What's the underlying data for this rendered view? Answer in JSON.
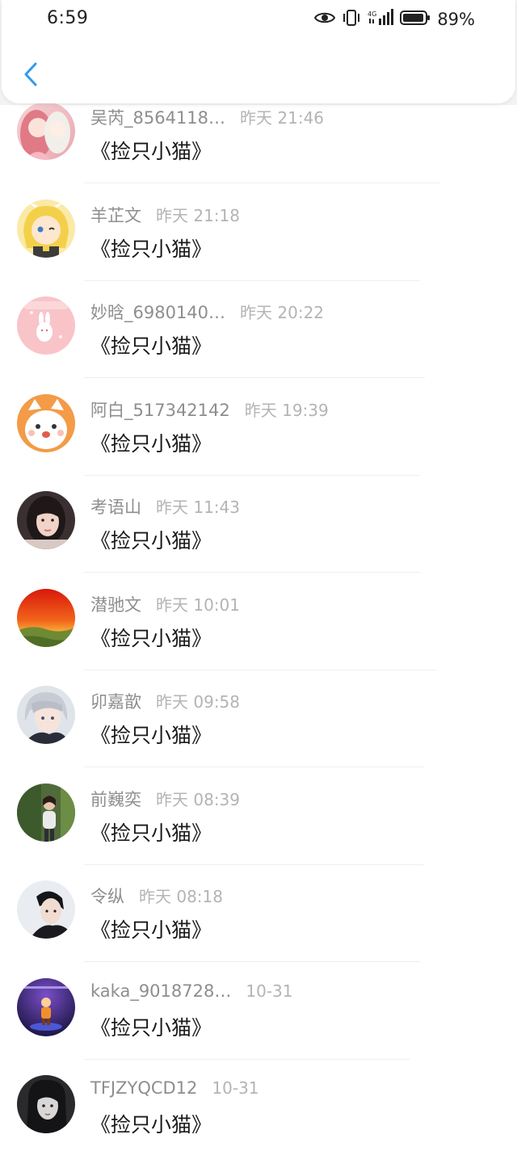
{
  "status_bar": {
    "time": "6:59",
    "network": "4G",
    "battery": "89%",
    "icons": [
      "eye-icon",
      "vibrate-icon",
      "signal-icon",
      "battery-icon"
    ]
  },
  "header": {
    "back_icon": "chevron-left-icon",
    "accent": "#2f9bf0"
  },
  "messages": [
    {
      "name": "吴芮_8564118…",
      "time": "昨天 21:46",
      "text": "《捡只小猫》",
      "avatar": "anime-girls"
    },
    {
      "name": "羊芷文",
      "time": "昨天 21:18",
      "text": "《捡只小猫》",
      "avatar": "anime-blonde"
    },
    {
      "name": "妙晗_6980140…",
      "time": "昨天 20:22",
      "text": "《捡只小猫》",
      "avatar": "pink-bunny"
    },
    {
      "name": "阿白_517342142",
      "time": "昨天 19:39",
      "text": "《捡只小猫》",
      "avatar": "orange-cartoon"
    },
    {
      "name": "考语山",
      "time": "昨天 11:43",
      "text": "《捡只小猫》",
      "avatar": "portrait-dark"
    },
    {
      "name": "潜驰文",
      "time": "昨天 10:01",
      "text": "《捡只小猫》",
      "avatar": "sunset"
    },
    {
      "name": "卯嘉歆",
      "time": "昨天 09:58",
      "text": "《捡只小猫》",
      "avatar": "anime-silver"
    },
    {
      "name": "前巍奕",
      "time": "昨天 08:39",
      "text": "《捡只小猫》",
      "avatar": "outdoor-girl"
    },
    {
      "name": "令纵",
      "time": "昨天 08:18",
      "text": "《捡只小猫》",
      "avatar": "portrait-boy"
    },
    {
      "name": "kaka_9018728…",
      "time": "10-31",
      "text": "《捡只小猫》",
      "avatar": "stage-purple"
    },
    {
      "name": "TFJZYQCD12",
      "time": "10-31",
      "text": "《捡只小猫》",
      "avatar": "portrait-gray"
    }
  ]
}
